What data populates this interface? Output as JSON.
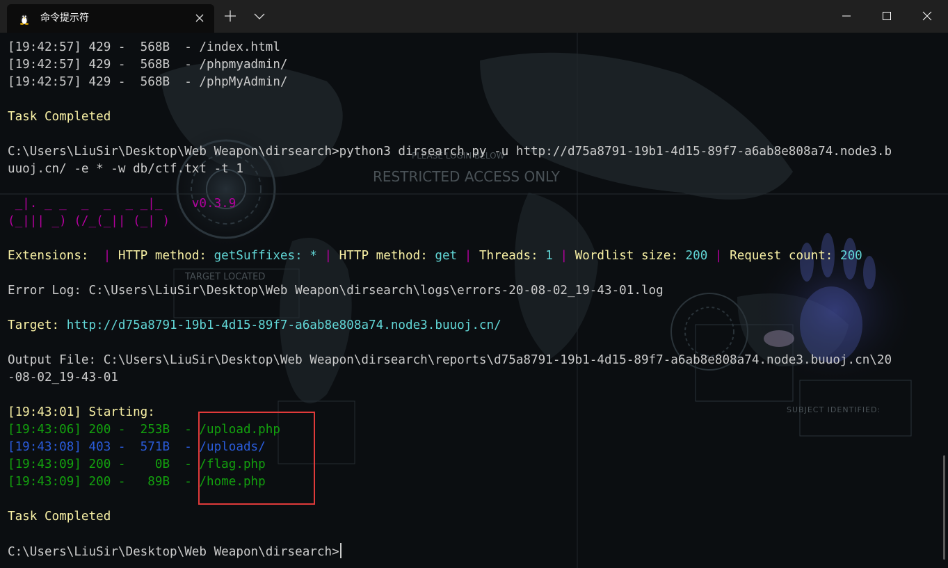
{
  "window": {
    "tab_title": "命令提示符",
    "icons": {
      "tab_icon": "linux-penguin-icon",
      "tab_close": "close-icon",
      "new_tab": "plus-icon",
      "dropdown": "chevron-down-icon",
      "minimize": "minimize-icon",
      "maximize": "maximize-icon",
      "close": "close-icon"
    }
  },
  "background": {
    "text1": "PLEASE LOGIN BELOW",
    "text2": "RESTRICTED ACCESS ONLY",
    "text3": "TARGET LOCATED",
    "text4": "SUBJECT IDENTIFIED:"
  },
  "terminal": {
    "lines": [
      [
        {
          "t": "[19:42:57] 429 -  568B  - /index.html",
          "c": "default"
        }
      ],
      [
        {
          "t": "[19:42:57] 429 -  568B  - /phpmyadmin/",
          "c": "default"
        }
      ],
      [
        {
          "t": "[19:42:57] 429 -  568B  - /phpMyAdmin/",
          "c": "default"
        }
      ],
      [],
      [
        {
          "t": "Task Completed",
          "c": "yellow"
        }
      ],
      [],
      [
        {
          "t": "C:\\Users\\LiuSir\\Desktop\\Web Weapon\\dirsearch>python3 dirsearch.py -u http://d75a8791-19b1-4d15-89f7-a6ab8e808a74.node3.b",
          "c": "default"
        }
      ],
      [
        {
          "t": "uuoj.cn/ -e * -w db/ctf.txt -t 1",
          "c": "default"
        }
      ],
      [],
      [
        {
          "t": " _|. _ _  _  _  _ _|_    v0.3.9",
          "c": "magenta"
        }
      ],
      [
        {
          "t": "(_||| _) (/_(_|| (_| )",
          "c": "magenta"
        }
      ],
      [],
      [
        {
          "t": "Extensions: ",
          "c": "yellow"
        },
        {
          "t": " | ",
          "c": "magenta"
        },
        {
          "t": "HTTP method: ",
          "c": "yellow"
        },
        {
          "t": "getSuffixes: *",
          "c": "cyan"
        },
        {
          "t": " | ",
          "c": "magenta"
        },
        {
          "t": "HTTP method: ",
          "c": "yellow"
        },
        {
          "t": "get",
          "c": "cyan"
        },
        {
          "t": " | ",
          "c": "magenta"
        },
        {
          "t": "Threads: ",
          "c": "yellow"
        },
        {
          "t": "1",
          "c": "cyan"
        },
        {
          "t": " | ",
          "c": "magenta"
        },
        {
          "t": "Wordlist size: ",
          "c": "yellow"
        },
        {
          "t": "200",
          "c": "cyan"
        },
        {
          "t": " | ",
          "c": "magenta"
        },
        {
          "t": "Request count: ",
          "c": "yellow"
        },
        {
          "t": "200",
          "c": "cyan"
        }
      ],
      [],
      [
        {
          "t": "Error Log: C:\\Users\\LiuSir\\Desktop\\Web Weapon\\dirsearch\\logs\\errors-20-08-02_19-43-01.log",
          "c": "default"
        }
      ],
      [],
      [
        {
          "t": "Target: ",
          "c": "yellow"
        },
        {
          "t": "http://d75a8791-19b1-4d15-89f7-a6ab8e808a74.node3.buuoj.cn/",
          "c": "cyan"
        }
      ],
      [],
      [
        {
          "t": "Output File: C:\\Users\\LiuSir\\Desktop\\Web Weapon\\dirsearch\\reports\\d75a8791-19b1-4d15-89f7-a6ab8e808a74.node3.buuoj.cn\\20",
          "c": "default"
        }
      ],
      [
        {
          "t": "-08-02_19-43-01",
          "c": "default"
        }
      ],
      [],
      [
        {
          "t": "[19:43:01] Starting:",
          "c": "yellow"
        }
      ],
      [
        {
          "t": "[19:43:06] 200 -  253B  - /upload.php",
          "c": "green"
        }
      ],
      [
        {
          "t": "[19:43:08] 403 -  571B  - /uploads/",
          "c": "blue"
        }
      ],
      [
        {
          "t": "[19:43:09] 200 -    0B  - /flag.php",
          "c": "green"
        }
      ],
      [
        {
          "t": "[19:43:09] 200 -   89B  - /home.php",
          "c": "green"
        }
      ],
      [],
      [
        {
          "t": "Task Completed",
          "c": "yellow"
        }
      ],
      [],
      [
        {
          "t": "C:\\Users\\LiuSir\\Desktop\\Web Weapon\\dirsearch>",
          "c": "default"
        }
      ]
    ]
  },
  "colors": {
    "titlebar": "#202020",
    "terminal_bg": "#0c0c0c",
    "default_text": "#cccccc",
    "yellow": "#f9f1a5",
    "cyan": "#61d6d6",
    "magenta": "#b4009e",
    "green": "#13a10e",
    "blue": "#2a5cdb",
    "highlight_box": "#e03a3a"
  }
}
